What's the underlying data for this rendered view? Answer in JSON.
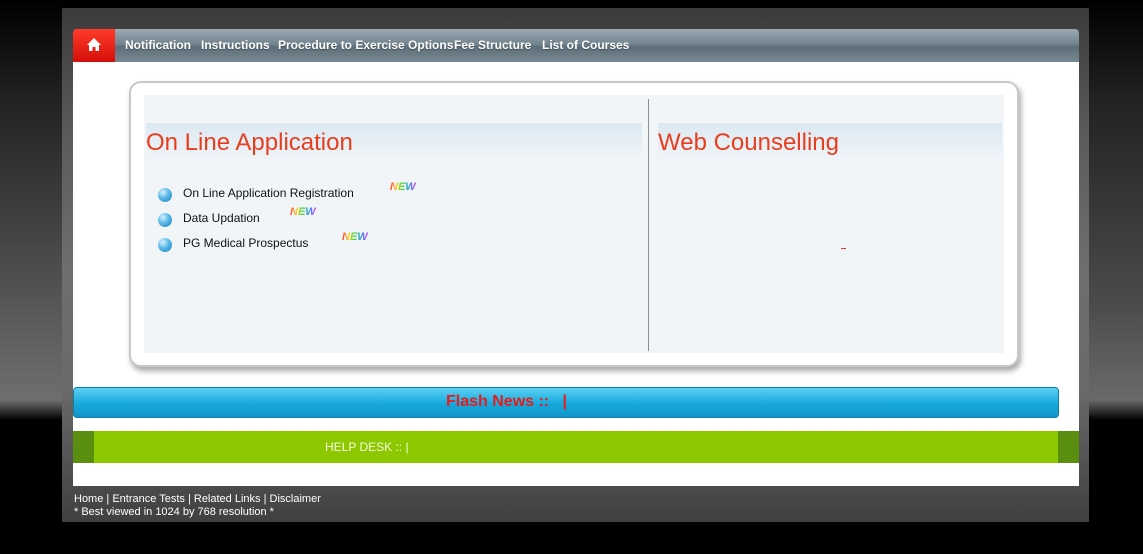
{
  "nav": {
    "home_icon": "home-icon",
    "items": [
      "Notification",
      "Instructions",
      "Procedure to Exercise Options",
      "Fee Structure",
      "List of Courses"
    ]
  },
  "online_application": {
    "title": "On Line Application",
    "links": [
      {
        "label": "On Line Application Registration",
        "badge": "NEW"
      },
      {
        "label": "Data Updation",
        "badge": "NEW"
      },
      {
        "label": "PG Medical Prospectus",
        "badge": "NEW"
      }
    ]
  },
  "web_counselling": {
    "title": "Web Counselling"
  },
  "flash_news": {
    "label": "Flash News ::",
    "separator": "|"
  },
  "help_desk": {
    "label": "HELP DESK :: |"
  },
  "footer": {
    "links": [
      "Home",
      "Entrance Tests",
      "Related Links",
      "Disclaimer"
    ],
    "separator": " | ",
    "note": "* Best viewed in 1024 by 768 resolution *"
  },
  "colors": {
    "title_red": "#e83e1e",
    "flash_blue": "#16a8dc",
    "helpdesk_green": "#8cc700",
    "home_red": "#d40f0a"
  }
}
